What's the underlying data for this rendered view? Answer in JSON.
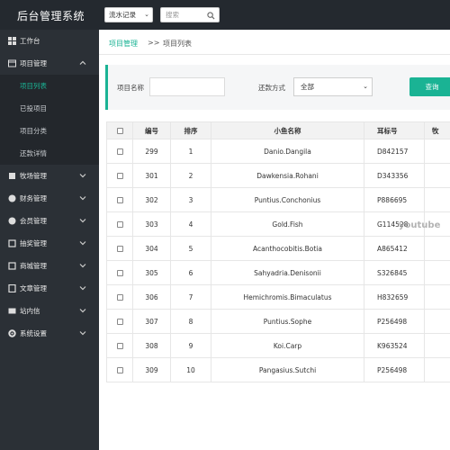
{
  "app": {
    "title": "后台管理系统"
  },
  "topbar": {
    "select_value": "流水记录",
    "search_placeholder": "搜索"
  },
  "sidebar": {
    "items": [
      {
        "label": "工作台",
        "icon": "dashboard-icon",
        "expandable": false
      },
      {
        "label": "项目管理",
        "icon": "project-icon",
        "expandable": true,
        "expanded": true,
        "children": [
          {
            "label": "项目列表",
            "active": true
          },
          {
            "label": "已投项目",
            "active": false
          },
          {
            "label": "项目分类",
            "active": false
          },
          {
            "label": "还款详情",
            "active": false
          }
        ]
      },
      {
        "label": "牧场管理",
        "icon": "ranch-icon",
        "expandable": true
      },
      {
        "label": "财务管理",
        "icon": "finance-icon",
        "expandable": true
      },
      {
        "label": "会员管理",
        "icon": "member-icon",
        "expandable": true
      },
      {
        "label": "抽奖管理",
        "icon": "lottery-icon",
        "expandable": true
      },
      {
        "label": "商城管理",
        "icon": "mall-icon",
        "expandable": true
      },
      {
        "label": "文章管理",
        "icon": "article-icon",
        "expandable": true
      },
      {
        "label": "站内信",
        "icon": "message-icon",
        "expandable": true
      },
      {
        "label": "系统设置",
        "icon": "gear-icon",
        "expandable": true
      }
    ]
  },
  "breadcrumb": {
    "parent": "项目管理",
    "separator": ">>",
    "current": "项目列表"
  },
  "filter": {
    "name_label": "项目名称",
    "name_value": "",
    "repay_label": "还款方式",
    "repay_value": "全部",
    "query_label": "查询"
  },
  "table": {
    "columns": [
      "",
      "编号",
      "排序",
      "小鱼名称",
      "耳标号",
      "牧"
    ],
    "rows": [
      {
        "id": "299",
        "sort": "1",
        "name": "Danio.Dangila",
        "tag": "D842157"
      },
      {
        "id": "301",
        "sort": "2",
        "name": "Dawkensia.Rohani",
        "tag": "D343356"
      },
      {
        "id": "302",
        "sort": "3",
        "name": "Puntius.Conchonius",
        "tag": "P886695"
      },
      {
        "id": "303",
        "sort": "4",
        "name": "Gold.Fish",
        "tag": "G114528"
      },
      {
        "id": "304",
        "sort": "5",
        "name": "Acanthocobitis.Botia",
        "tag": "A865412"
      },
      {
        "id": "305",
        "sort": "6",
        "name": "Sahyadria.Denisonii",
        "tag": "S326845"
      },
      {
        "id": "306",
        "sort": "7",
        "name": "Hemichromis.Bimaculatus",
        "tag": "H832659"
      },
      {
        "id": "307",
        "sort": "8",
        "name": "Puntius.Sophe",
        "tag": "P256498"
      },
      {
        "id": "308",
        "sort": "9",
        "name": "Koi.Carp",
        "tag": "K963524"
      },
      {
        "id": "309",
        "sort": "10",
        "name": "Pangasius.Sutchi",
        "tag": "P256498"
      }
    ]
  },
  "watermark": "youtube",
  "colors": {
    "accent": "#1ab394",
    "sidebar_bg": "#2b3036",
    "topbar_bg": "#24292f"
  }
}
